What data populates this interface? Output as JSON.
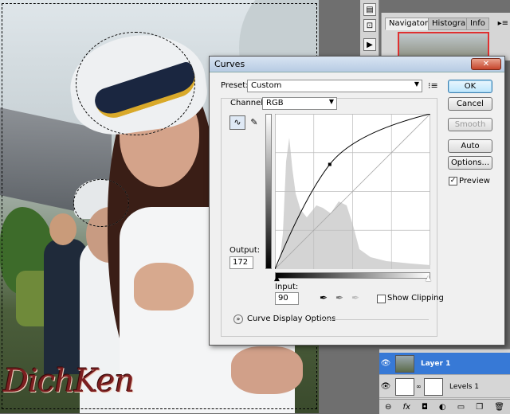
{
  "window": {
    "title": "Curves"
  },
  "photo": {
    "watermark": "DichKen"
  },
  "navigator": {
    "tabs": [
      {
        "label": "Navigator ×"
      },
      {
        "label": "Histogram"
      },
      {
        "label": "Info"
      }
    ]
  },
  "curves": {
    "preset_label": "Preset:",
    "preset_value": "Custom",
    "channel_label": "Channel:",
    "channel_value": "RGB",
    "output_label": "Output:",
    "output_value": "172",
    "input_label": "Input:",
    "input_value": "90",
    "show_clipping_label": "Show Clipping",
    "show_clipping_checked": false,
    "display_options_label": "Curve Display Options",
    "buttons": {
      "ok": "OK",
      "cancel": "Cancel",
      "smooth": "Smooth",
      "auto": "Auto",
      "options": "Options...",
      "preview": "Preview"
    },
    "preview_checked": true,
    "curve_point": {
      "input": 90,
      "output": 172
    }
  },
  "layers": {
    "items": [
      {
        "name": "Layer 1",
        "selected": true
      },
      {
        "name": "Levels 1",
        "selected": false
      }
    ],
    "footer_icons": [
      "link-icon",
      "fx-icon",
      "mask-icon",
      "adjustment-icon",
      "folder-icon",
      "new-layer-icon",
      "trash-icon"
    ]
  },
  "colors": {
    "selection_blue": "#3779d6",
    "close_red": "#c6452c",
    "watermark": "#7c1f20"
  }
}
